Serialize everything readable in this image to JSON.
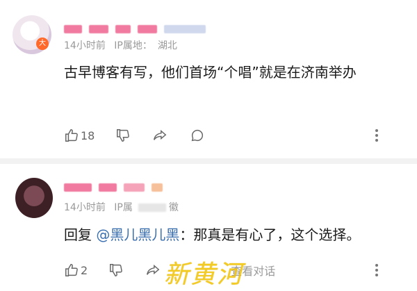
{
  "comments": [
    {
      "badge": "大",
      "time": "14小时前",
      "ip_label": "IP属地：",
      "ip_value": "湖北",
      "text": "古早博客有写，他们首场“个唱”就是在济南举办",
      "likes": "18",
      "icons": [
        "thumbs-up-icon",
        "thumbs-down-icon",
        "share-icon",
        "comment-icon",
        "more-icon"
      ]
    },
    {
      "time": "14小时前",
      "ip_label": "IP属",
      "ip_value": "徽",
      "reply_prefix": "回复",
      "mention": "@黑儿黑儿黑",
      "text": "：那真是有心了，这个选择。",
      "likes": "2",
      "view_conversation": "查看对话",
      "icons": [
        "thumbs-up-icon",
        "thumbs-down-icon",
        "share-icon",
        "more-icon"
      ]
    }
  ],
  "watermark": "新黄河",
  "colors": {
    "mention": "#3a6fb0",
    "meta": "#999999",
    "watermark": "#f2c200",
    "name_blur": "#f07aa0"
  }
}
